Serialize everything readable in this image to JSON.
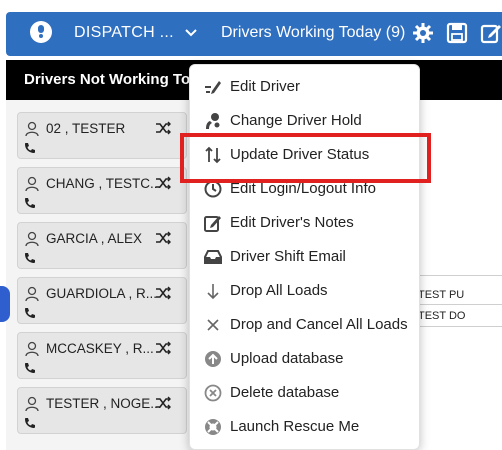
{
  "header": {
    "dispatch_label": "DISPATCH ...",
    "drivers_working": "Drivers Working Today (9)",
    "icons": [
      "user-circle-icon",
      "chevron-down-icon",
      "gear-icon",
      "save-icon",
      "edit-icon"
    ],
    "accent_color": "#2f6fbf"
  },
  "section": {
    "title": "Drivers Not Working Today"
  },
  "drivers": [
    {
      "name": "02 , TESTER"
    },
    {
      "name": "CHANG , TESTC..."
    },
    {
      "name": "GARCIA , ALEX"
    },
    {
      "name": "GUARDIOLA , R..."
    },
    {
      "name": "MCCASKEY , R..."
    },
    {
      "name": "TESTER , NOGE..."
    }
  ],
  "table": {
    "cells": [
      "TEST PU",
      "TEST DO"
    ]
  },
  "context_menu": {
    "items": [
      {
        "label": "Edit Driver",
        "icon": "edit-driver-icon"
      },
      {
        "label": "Change Driver Hold",
        "icon": "driver-hold-icon"
      },
      {
        "label": "Update Driver Status",
        "icon": "sort-arrows-icon"
      },
      {
        "label": "Edit Login/Logout Info",
        "icon": "clock-icon"
      },
      {
        "label": "Edit Driver's Notes",
        "icon": "note-edit-icon"
      },
      {
        "label": "Driver Shift Email",
        "icon": "inbox-icon"
      },
      {
        "label": "Drop All Loads",
        "icon": "arrow-down-icon"
      },
      {
        "label": "Drop and Cancel All Loads",
        "icon": "close-icon"
      },
      {
        "label": "Upload database",
        "icon": "upload-icon"
      },
      {
        "label": "Delete database",
        "icon": "delete-icon"
      },
      {
        "label": "Launch Rescue Me",
        "icon": "lifebuoy-icon"
      }
    ],
    "highlighted_item": "Update Driver Status",
    "highlight_color": "#e0211f"
  }
}
